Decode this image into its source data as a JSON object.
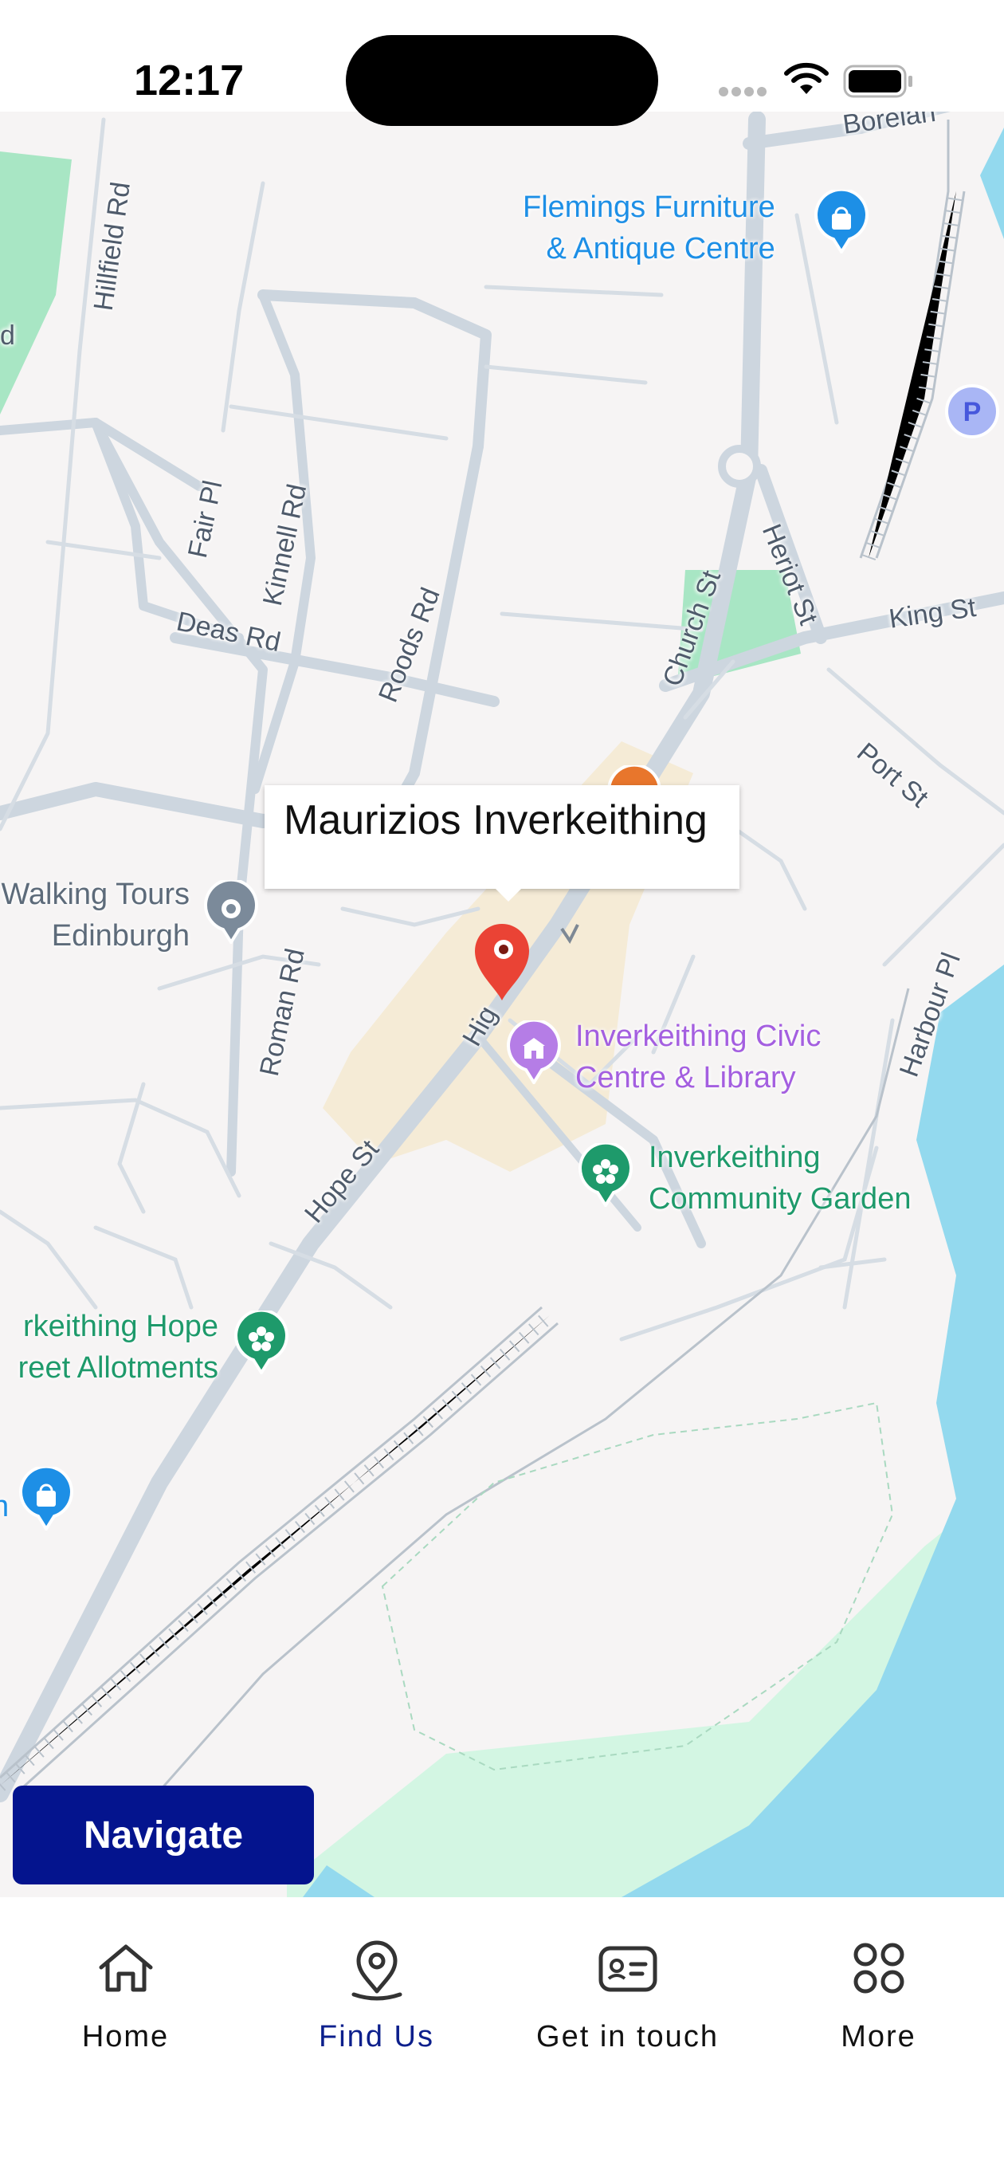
{
  "status_bar": {
    "time": "12:17"
  },
  "map": {
    "streets": {
      "hillfield_rd": "Hillfield Rd",
      "fair_pl": "Fair Pl",
      "kinnell_rd": "Kinnell Rd",
      "deas_rd": "Deas Rd",
      "roods_rd": "Roods Rd",
      "church_st": "Church St",
      "heriot_st": "Heriot St",
      "king_st": "King St",
      "port_st": "Port St",
      "roman_rd": "Roman Rd",
      "hope_st": "Hope St",
      "high_st": "Hig",
      "harbour_pl": "Harbour Pl",
      "boreland": "Borelan",
      "park_edge": "d"
    },
    "pois": {
      "flemings": {
        "line1": "Flemings Furniture",
        "line2": "& Antique Centre",
        "icon": "shopping-bag-icon",
        "color": "#1d8fe6"
      },
      "walking_tours": {
        "line1": "Walking Tours",
        "line2": "Edinburgh",
        "icon": "landmark-icon",
        "color": "#7b8a9a"
      },
      "civic_centre": {
        "line1": "Inverkeithing Civic",
        "line2": "Centre & Library",
        "icon": "building-icon",
        "color": "#a45fe0"
      },
      "community_garden": {
        "line1": "Inverkeithing",
        "line2": "Community Garden",
        "icon": "flower-icon",
        "color": "#1e9a6b"
      },
      "allotments": {
        "line1": "rkeithing Hope",
        "line2": "reet Allotments",
        "icon": "flower-icon",
        "color": "#1e9a6b"
      },
      "shop_left": {
        "line1": "n",
        "icon": "shopping-bag-icon",
        "color": "#1d8fe6"
      },
      "parking": {
        "icon": "parking-icon",
        "label": "P",
        "color": "#7b8cf0"
      }
    },
    "callout": {
      "title": "Maurizios Inverkeithing"
    },
    "marker": {
      "icon": "location-pin-icon",
      "color": "#ea4335"
    }
  },
  "actions": {
    "navigate_label": "Navigate"
  },
  "tab_bar": {
    "active_tab": "Find Us",
    "tabs": [
      {
        "label": "Home",
        "icon": "home-icon"
      },
      {
        "label": "Find Us",
        "icon": "location-icon"
      },
      {
        "label": "Get in touch",
        "icon": "contact-card-icon"
      },
      {
        "label": "More",
        "icon": "grid-icon"
      }
    ]
  },
  "colors": {
    "accent": "#04148e",
    "active_tab": "#0c1f8c",
    "water": "#93d9ee",
    "park": "#a8e6c4",
    "road": "#cdd6df",
    "town_area": "#f5ebd6"
  }
}
